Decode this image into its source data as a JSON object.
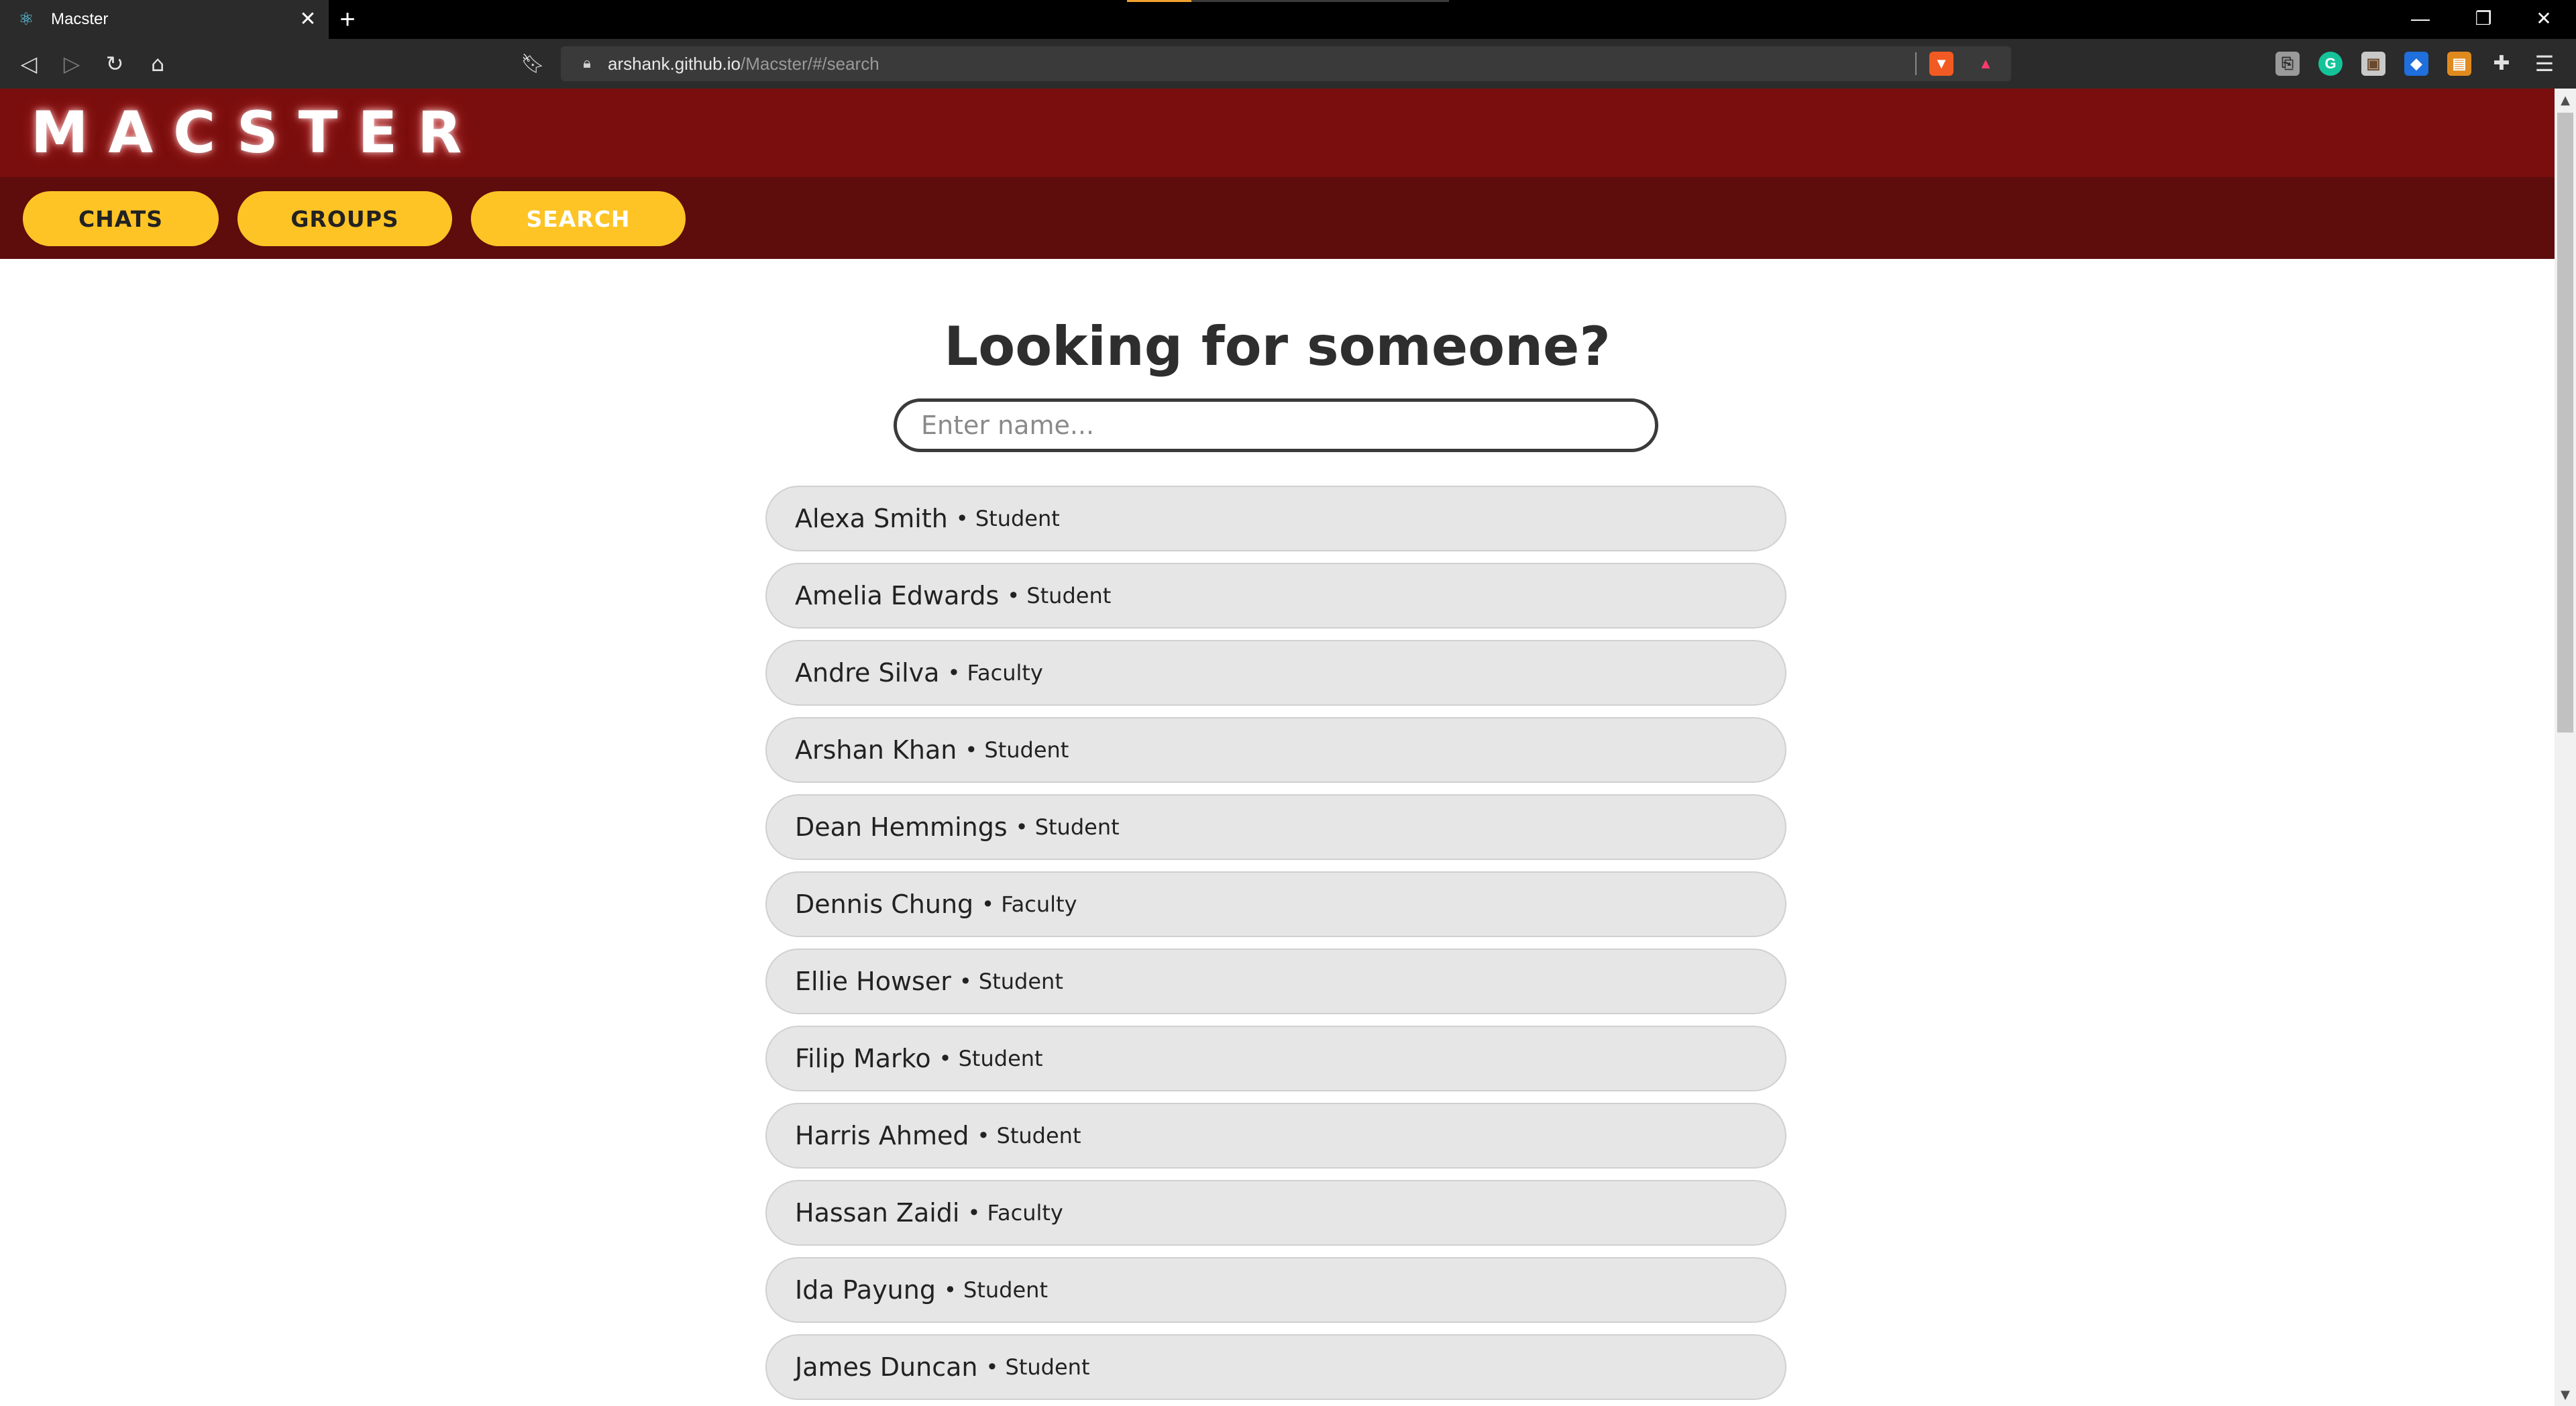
{
  "browser": {
    "tab_title": "Macster",
    "tab_favicon_icon": "react-atom-icon",
    "new_tab_symbol": "+",
    "close_tab_symbol": "✕",
    "url_host": "arshank.github.io",
    "url_path": "/Macster/#/search",
    "window_controls": {
      "minimize": "—",
      "restore": "❐",
      "close": "✕"
    }
  },
  "app": {
    "logo": "MACSTER",
    "nav": [
      {
        "label": "CHATS",
        "active": false
      },
      {
        "label": "GROUPS",
        "active": false
      },
      {
        "label": "SEARCH",
        "active": true
      }
    ],
    "accent_color": "#fec425",
    "header_color": "#7a0e0e"
  },
  "search": {
    "heading": "Looking for someone?",
    "placeholder": "Enter name...",
    "value": ""
  },
  "results": [
    {
      "name": "Alexa Smith",
      "role": "• Student"
    },
    {
      "name": "Amelia Edwards",
      "role": "• Student"
    },
    {
      "name": "Andre Silva",
      "role": "• Faculty"
    },
    {
      "name": "Arshan Khan",
      "role": "• Student"
    },
    {
      "name": "Dean Hemmings",
      "role": "• Student"
    },
    {
      "name": "Dennis Chung",
      "role": "• Faculty"
    },
    {
      "name": "Ellie Howser",
      "role": "• Student"
    },
    {
      "name": "Filip Marko",
      "role": "• Student"
    },
    {
      "name": "Harris Ahmed",
      "role": "• Student"
    },
    {
      "name": "Hassan Zaidi",
      "role": "• Faculty"
    },
    {
      "name": "Ida Payung",
      "role": "• Student"
    },
    {
      "name": "James Duncan",
      "role": "• Student"
    }
  ]
}
